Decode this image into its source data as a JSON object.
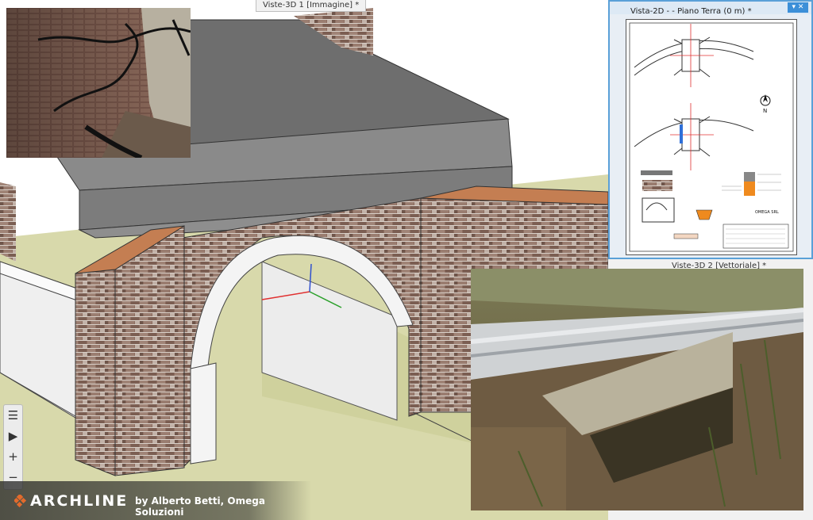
{
  "viewport_main": {
    "title": "Viste-3D 1 [Immagine] *"
  },
  "viewport_2d": {
    "title": "Vista-2D -  - Piano Terra (0 m) *",
    "window_controls": "▾ ✕"
  },
  "viewport_3d2": {
    "title": "Viste-3D 2 [Vettoriale] *"
  },
  "sheet": {
    "company": "OMEGA SRL",
    "north_label": "N"
  },
  "toolbar": {
    "items": [
      {
        "icon": "list-icon",
        "glyph": "☰"
      },
      {
        "icon": "play-icon",
        "glyph": "▶"
      },
      {
        "icon": "zoom-in-icon",
        "glyph": "+"
      },
      {
        "icon": "zoom-out-icon",
        "glyph": "−"
      }
    ]
  },
  "brand": {
    "logo_text": "ARCHLINE",
    "byline": "by Alberto Betti, Omega Soluzioni"
  },
  "colors": {
    "accent": "#5aa0d8",
    "brick": "#8a6a5c",
    "roof": "#6d6d6d",
    "ground": "#d9dcae"
  }
}
